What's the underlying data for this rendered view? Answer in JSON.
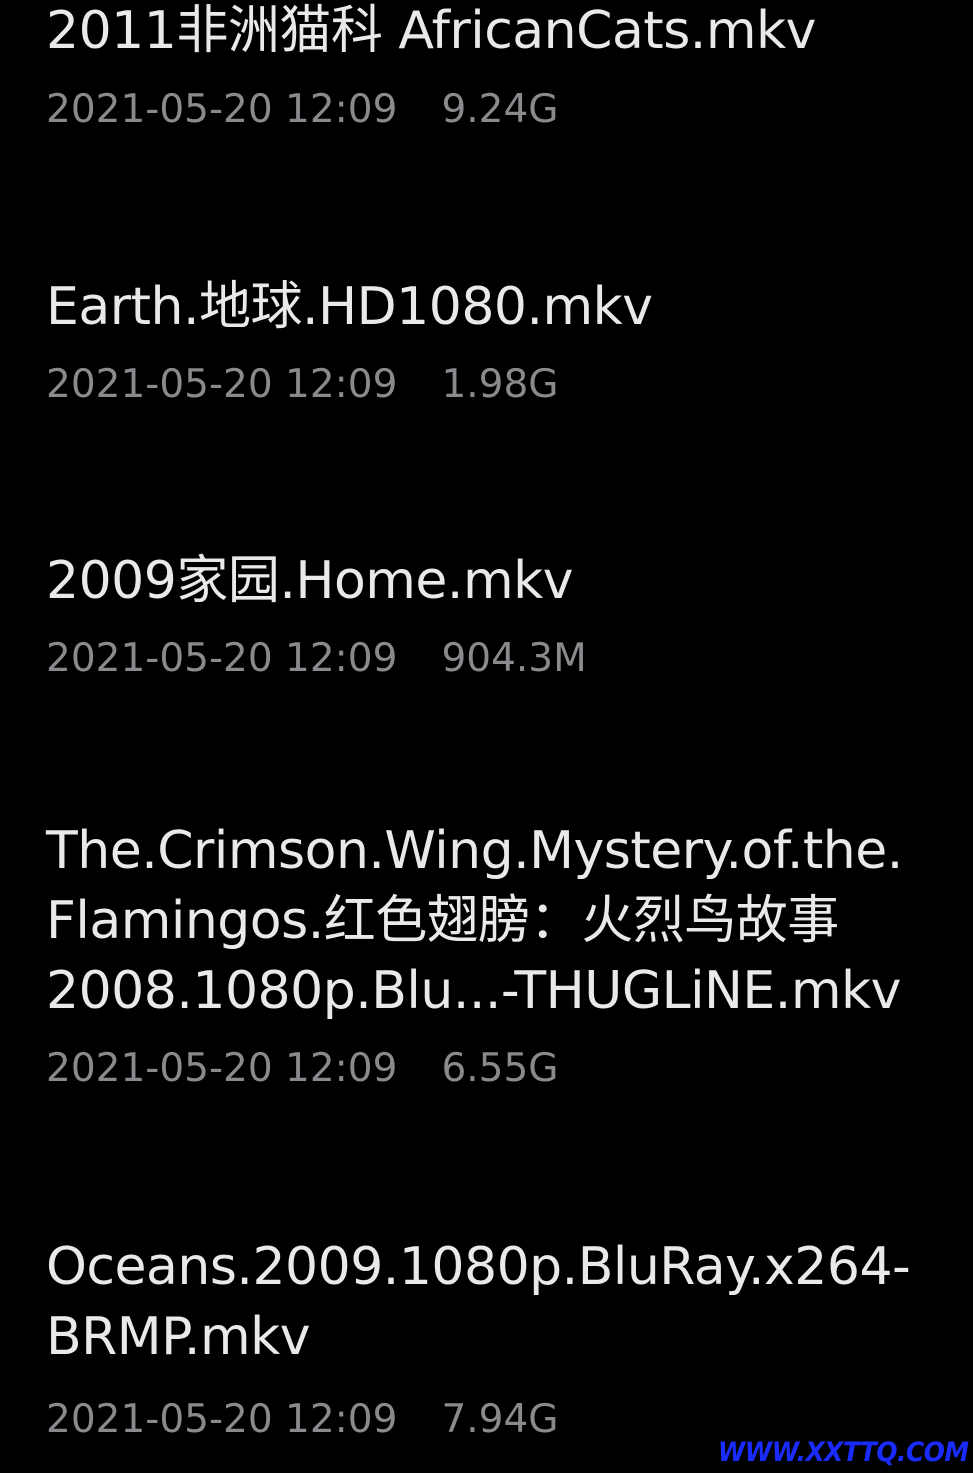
{
  "files": [
    {
      "name": "2011非洲猫科 AfricanCats.mkv",
      "date": "2021-05-20 12:09",
      "size": "9.24G"
    },
    {
      "name": "Earth.地球.HD1080.mkv",
      "date": "2021-05-20 12:09",
      "size": "1.98G"
    },
    {
      "name": "2009家园.Home.mkv",
      "date": "2021-05-20 12:09",
      "size": "904.3M"
    },
    {
      "name": "The.Crimson.Wing.Mystery.of.the.\nFlamingos.红色翅膀：火烈鸟故事\n2008.1080p.Blu...-THUGLiNE.mkv",
      "date": "2021-05-20 12:09",
      "size": "6.55G"
    },
    {
      "name": "Oceans.2009.1080p.BluRay.x264-\nBRMP.mkv",
      "date": "2021-05-20 12:09",
      "size": "7.94G"
    }
  ],
  "watermark": "WWW.XXTTQ.COM",
  "colors": {
    "background": "#000000",
    "name_text": "#e9e9ea",
    "meta_text": "#8a8a8e",
    "watermark": "#1a2bff"
  }
}
